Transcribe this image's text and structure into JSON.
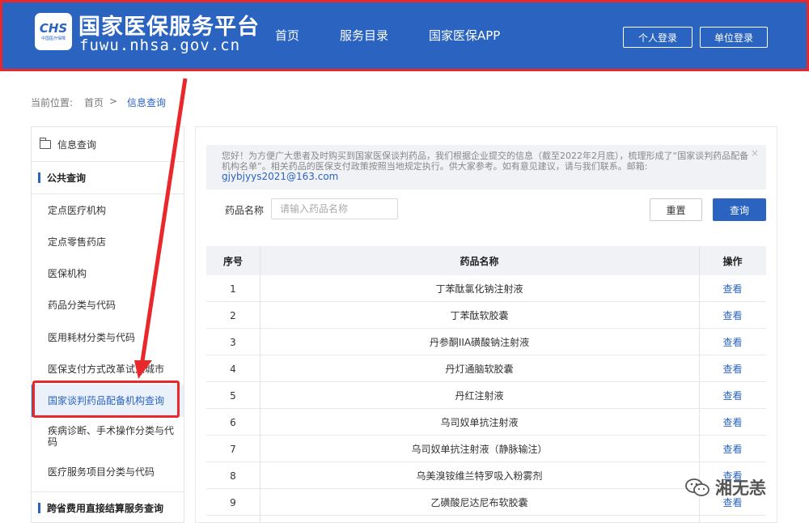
{
  "header": {
    "logo_text": "CHS",
    "logo_sub": "中国医疗保障",
    "title": "国家医保服务平台",
    "url": "fuwu.nhsa.gov.cn",
    "nav": [
      "首页",
      "服务目录",
      "国家医保APP"
    ],
    "personal_login": "个人登录",
    "unit_login": "单位登录"
  },
  "breadcrumb": {
    "prefix": "当前位置:",
    "home": "首页",
    "separator": ">",
    "current": "信息查询"
  },
  "sidebar": {
    "title": "信息查询",
    "section1": "公共查询",
    "items": [
      "定点医疗机构",
      "定点零售药店",
      "医保机构",
      "药品分类与代码",
      "医用耗材分类与代码",
      "医保支付方式改革试点城市",
      "国家谈判药品配备机构查询",
      "疾病诊断、手术操作分类与代码",
      "医疗服务项目分类与代码"
    ],
    "active_index": 6,
    "section2": "跨省费用直接结算服务查询"
  },
  "notice": {
    "text": "您好！为方便广大患者及时购买到国家医保谈判药品，我们根据企业提交的信息（截至2022年2月底），梳理形成了“国家谈判药品配备机构名单”。相关药品的医保支付政策按照当地规定执行。供大家参考。如有意见建议，请与我们联系。邮箱:",
    "email": "gjybjyys2021@163.com",
    "close": "×"
  },
  "search": {
    "label": "药品名称",
    "placeholder": "请输入药品名称",
    "value": "",
    "reset": "重置",
    "query": "查询"
  },
  "table": {
    "headers": [
      "序号",
      "药品名称",
      "操作"
    ],
    "rows": [
      {
        "no": "1",
        "name": "丁苯酞氯化钠注射液",
        "action": "查看"
      },
      {
        "no": "2",
        "name": "丁苯酞软胶囊",
        "action": "查看"
      },
      {
        "no": "3",
        "name": "丹参酮IIA磺酸钠注射液",
        "action": "查看"
      },
      {
        "no": "4",
        "name": "丹灯通脑软胶囊",
        "action": "查看"
      },
      {
        "no": "5",
        "name": "丹红注射液",
        "action": "查看"
      },
      {
        "no": "6",
        "name": "乌司奴单抗注射液",
        "action": "查看"
      },
      {
        "no": "7",
        "name": "乌司奴单抗注射液（静脉输注）",
        "action": "查看"
      },
      {
        "no": "8",
        "name": "乌美溴铵维兰特罗吸入粉雾剂",
        "action": "查看"
      },
      {
        "no": "9",
        "name": "乙磺酸尼达尼布软胶囊",
        "action": "查看"
      }
    ]
  },
  "watermark": "湘无恙",
  "colors": {
    "brand": "#2a64c0",
    "highlight": "#e8282b"
  }
}
